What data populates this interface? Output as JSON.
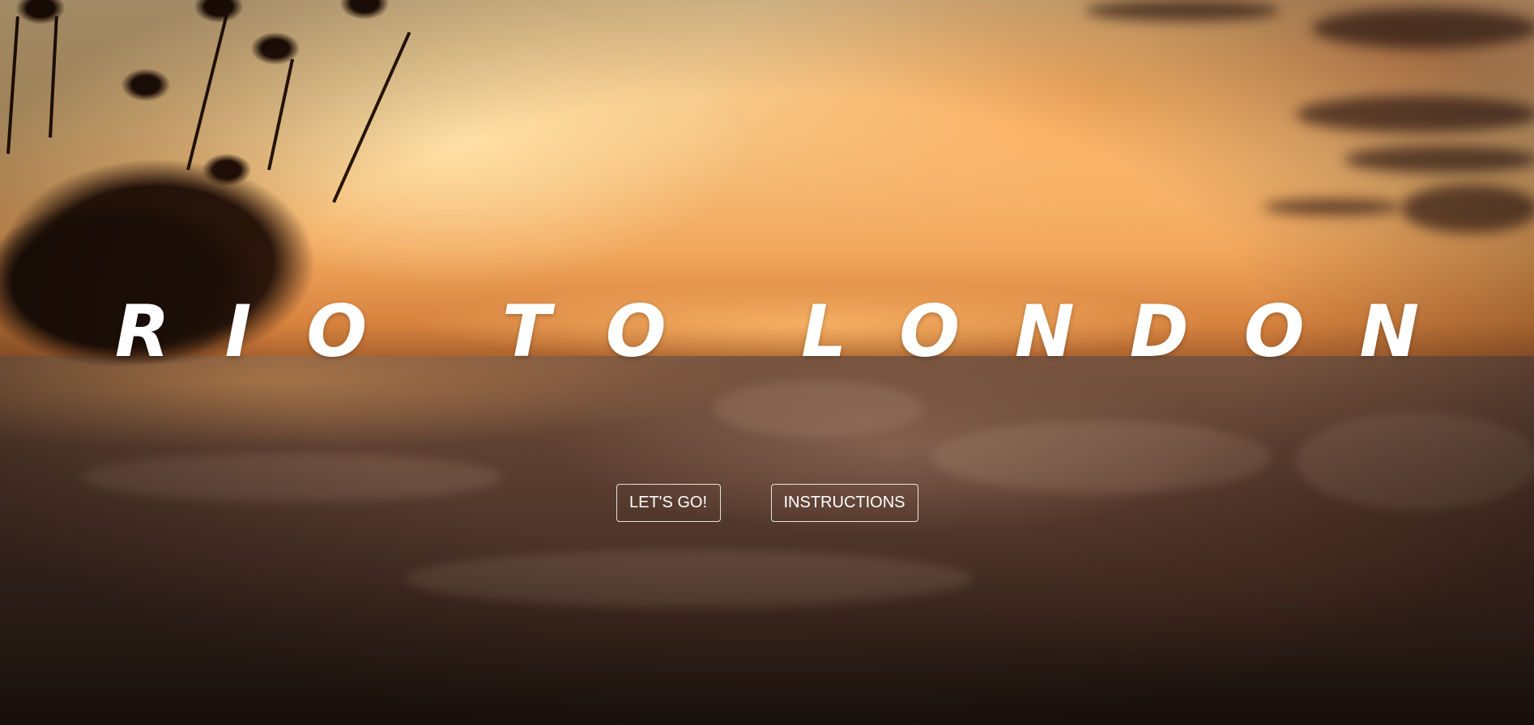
{
  "hero": {
    "title": "RIO TO LONDON"
  },
  "buttons": {
    "start_label": "LET'S GO!",
    "instructions_label": "INSTRUCTIONS"
  },
  "colors": {
    "text": "#ffffff",
    "button_border": "#ffffff"
  }
}
